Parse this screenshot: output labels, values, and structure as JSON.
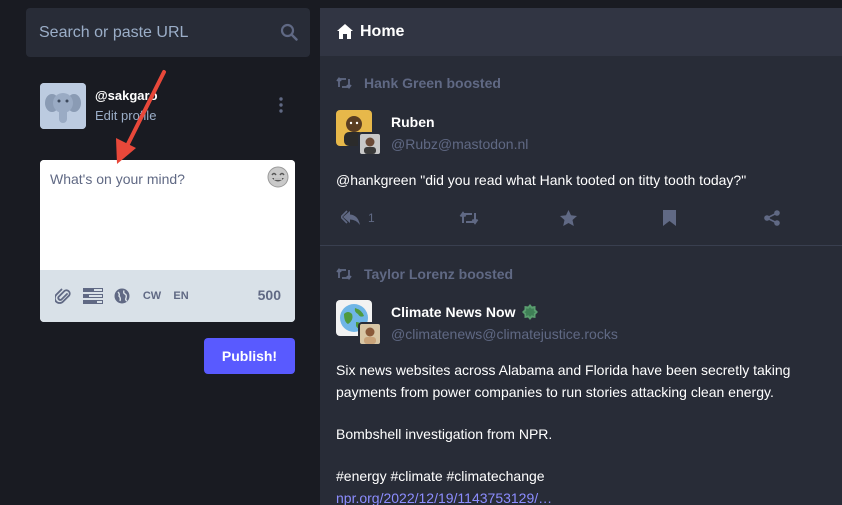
{
  "search": {
    "placeholder": "Search or paste URL",
    "icon": "search-icon"
  },
  "profile": {
    "handle": "@sakgaro",
    "edit_label": "Edit profile"
  },
  "compose": {
    "placeholder": "What's on your mind?",
    "tools": [
      "paperclip-icon",
      "poll-icon",
      "globe-icon"
    ],
    "cw_label": "CW",
    "lang_label": "EN",
    "char_count": "500",
    "publish_label": "Publish!"
  },
  "column": {
    "title": "Home",
    "icon": "home-icon"
  },
  "statuses": [
    {
      "boosted_by": "Hank Green boosted",
      "display_name": "Ruben",
      "acct": "@Rubz@mastodon.nl",
      "content": "@hankgreen \"did you read what Hank tooted on titty tooth today?\"",
      "reply_count": "1"
    },
    {
      "boosted_by": "Taylor Lorenz boosted",
      "display_name": "Climate News Now",
      "acct": "@climatenews@climatejustice.rocks",
      "paragraph1": "Six news websites across Alabama and Florida have been secretly taking payments from power companies to run stories attacking clean energy.",
      "paragraph2": "Bombshell investigation from NPR.",
      "hashtags": "#energy #climate #climatechange",
      "link": "npr.org/2022/12/19/1143753129/…"
    }
  ],
  "colors": {
    "background": "#191b22",
    "column": "#282c37",
    "accent": "#595aff",
    "muted": "#606984",
    "link": "#8c8dff",
    "arrow": "#e8483a"
  }
}
